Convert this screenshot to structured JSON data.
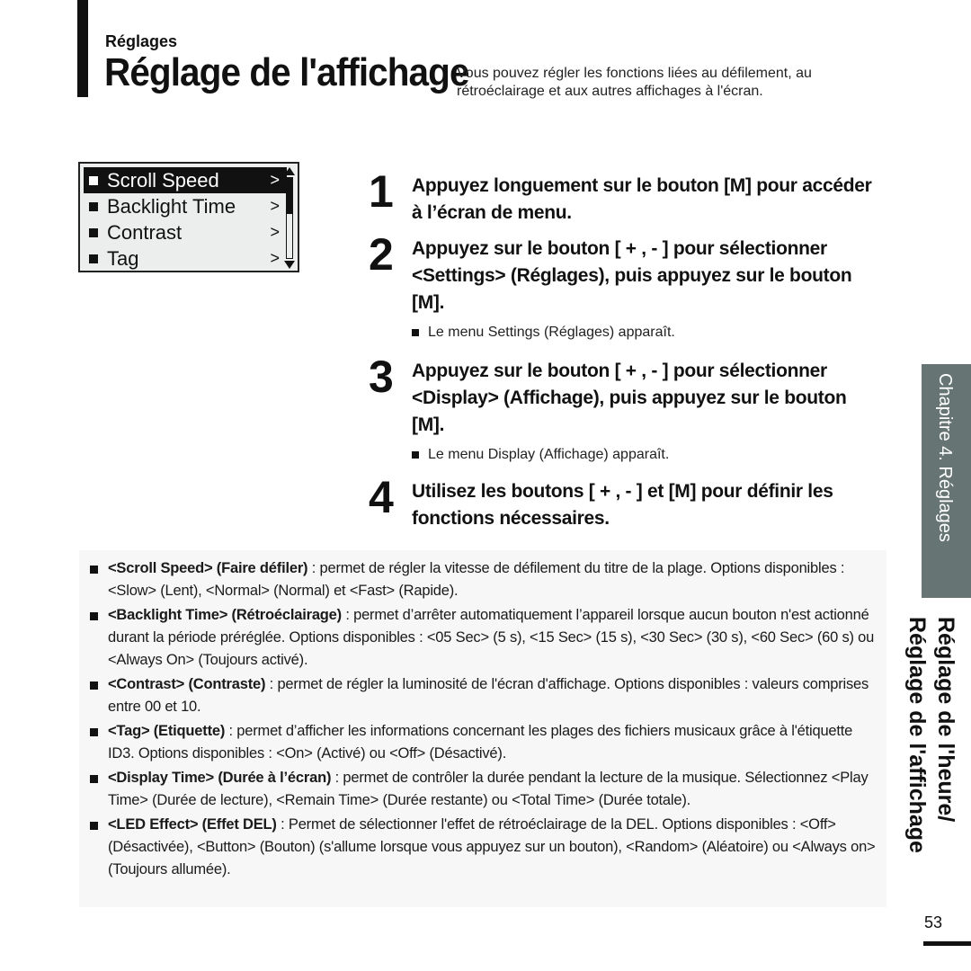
{
  "header": {
    "section_label": "Réglages",
    "page_title": "Réglage de l'affichage",
    "intro": "Vous pouvez régler les fonctions liées au défilement, au rétroéclairage et aux autres affichages à l'écran."
  },
  "lcd": {
    "items": [
      {
        "label": "Scroll Speed",
        "selected": true
      },
      {
        "label": "Backlight Time",
        "selected": false
      },
      {
        "label": "Contrast",
        "selected": false
      },
      {
        "label": "Tag",
        "selected": false
      }
    ],
    "arrow": ">",
    "scroll_position": 0.45
  },
  "steps": [
    {
      "num": "1",
      "text": "Appuyez longuement sur le bouton [M] pour accéder à l’écran de menu.",
      "note": ""
    },
    {
      "num": "2",
      "text": "Appuyez sur le bouton [ + , - ] pour sélectionner <Settings> (Réglages), puis appuyez sur le bouton [M].",
      "note": "Le menu Settings (Réglages) apparaît."
    },
    {
      "num": "3",
      "text": "Appuyez sur le bouton [ + , - ] pour sélectionner <Display> (Affichage), puis appuyez sur le bouton [M].",
      "note": "Le menu Display (Affichage) apparaît."
    },
    {
      "num": "4",
      "text": "Utilisez les boutons [ + , - ] et [M] pour définir les fonctions nécessaires.",
      "note": ""
    }
  ],
  "descriptions": [
    {
      "term": "<Scroll Speed> (Faire défiler)",
      "text": " : permet de régler la vitesse de défilement du titre de la plage. Options disponibles : <Slow> (Lent), <Normal> (Normal) et <Fast> (Rapide)."
    },
    {
      "term": "<Backlight Time> (Rétroéclairage)",
      "text": " : permet d’arrêter automatiquement l’appareil lorsque aucun bouton n'est actionné durant la période préréglée. Options disponibles : <05 Sec> (5 s), <15 Sec> (15 s), <30 Sec> (30 s), <60 Sec> (60 s) ou <Always On> (Toujours activé)."
    },
    {
      "term": "<Contrast> (Contraste)",
      "text": " : permet de régler la luminosité de l'écran d'affichage. Options disponibles : valeurs comprises entre 00 et 10."
    },
    {
      "term": "<Tag> (Etiquette)",
      "text": " : permet d’afficher les informations concernant les plages des fichiers musicaux grâce à l'étiquette ID3. Options disponibles : <On> (Activé) ou <Off> (Désactivé)."
    },
    {
      "term": "<Display Time> (Durée à l’écran)",
      "text": " : permet de contrôler la durée pendant la lecture de la musique. Sélectionnez <Play Time> (Durée de lecture), <Remain Time> (Durée restante) ou <Total Time> (Durée totale)."
    },
    {
      "term": "<LED Effect> (Effet DEL)",
      "text": " : Permet de sélectionner l'effet de rétroéclairage de la DEL. Options disponibles : <Off> (Désactivée), <Button> (Bouton) (s'allume lorsque vous appuyez sur un bouton), <Random> (Aléatoire) ou <Always on> (Toujours allumée)."
    }
  ],
  "sidebar": {
    "chapter_tab": "Chapitre 4. Réglages",
    "title_line1": "Réglage de l'heure/",
    "title_line2": "Réglage de l'affichage"
  },
  "footer": {
    "page_number": "53"
  },
  "colors": {
    "chapter_tab_bg": "#667573",
    "description_bg": "#f7f7f7",
    "lcd_bg": "#eceeed"
  }
}
